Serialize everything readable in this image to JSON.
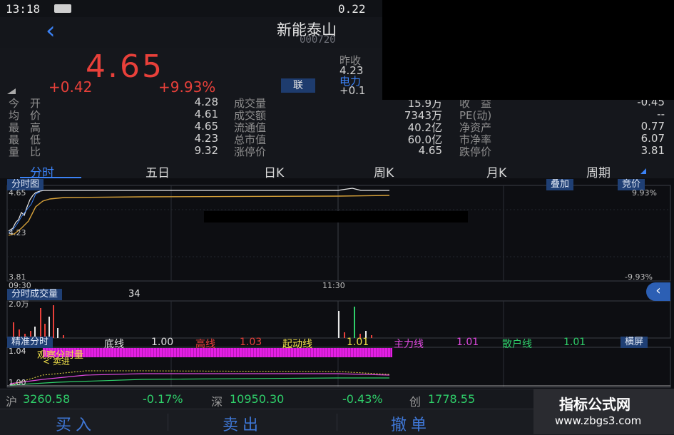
{
  "status": {
    "time": "13:18",
    "center_text": "0.22"
  },
  "header": {
    "stock_name": "新能泰山",
    "stock_code": "000720"
  },
  "quote": {
    "price": "4.65",
    "change": "+0.42",
    "change_pct": "+9.93%",
    "link_button": "联",
    "prev_close_label": "昨收",
    "prev_close_value": "4.23",
    "sector_label": "电力",
    "sector_change": "+0.1",
    "rows": [
      {
        "l1": "今　开",
        "v1": "4.28",
        "l2": "成交量",
        "v2": "15.9万",
        "l3": "收　益",
        "v3": "-0.45"
      },
      {
        "l1": "均　价",
        "v1": "4.61",
        "l2": "成交额",
        "v2": "7343万",
        "l3": "PE(动)",
        "v3": "--"
      },
      {
        "l1": "最　高",
        "v1": "4.65",
        "l2": "流通值",
        "v2": "40.2亿",
        "l3": "净资产",
        "v3": "0.77"
      },
      {
        "l1": "最　低",
        "v1": "4.23",
        "l2": "总市值",
        "v2": "60.0亿",
        "l3": "市净率",
        "v3": "6.07"
      },
      {
        "l1": "量　比",
        "v1": "9.32",
        "l2": "涨停价",
        "v2": "4.65",
        "l3": "跌停价",
        "v3": "3.81"
      }
    ]
  },
  "tabs": [
    "分时",
    "五日",
    "日K",
    "周K",
    "月K",
    "周期"
  ],
  "intraday": {
    "title": "分时图",
    "overlay_button": "叠加",
    "auction_button": "竞价",
    "high_label": "4.65",
    "mid_label": "4.23",
    "low_label": "3.81",
    "pct_high": "9.93%",
    "pct_low": "-9.93%",
    "time_start": "09:30",
    "time_mid": "11:30"
  },
  "volume": {
    "title": "分时成交量",
    "current": "34",
    "max_label": "2.0万"
  },
  "indicator": {
    "title": "精准分时",
    "items": [
      {
        "name": "底线",
        "value": "1.00",
        "color": "#e0e0e0"
      },
      {
        "name": "高线",
        "value": "1.03",
        "color": "#e8403a"
      },
      {
        "name": "起动线",
        "value": "1.01",
        "color": "#f0e04a"
      },
      {
        "name": "主力线",
        "value": "1.01",
        "color": "#e04ae0"
      },
      {
        "name": "散户线",
        "value": "1.01",
        "color": "#2fcf6a"
      }
    ],
    "fullscreen_button": "横屏",
    "top_label": "1.04",
    "bottom_label": "1.00",
    "sub_text_1": "观察分时量",
    "sub_text_2": "< 卖进"
  },
  "indices": [
    {
      "name": "沪",
      "value": "3260.58",
      "change": "-0.17%"
    },
    {
      "name": "深",
      "value": "10950.30",
      "change": "-0.43%"
    },
    {
      "name": "创",
      "value": "1778.55",
      "change": ""
    }
  ],
  "actions": {
    "buy": "买入",
    "sell": "卖出",
    "cancel": "撤单"
  },
  "watermark": {
    "line1": "指标公式网",
    "line2": "www.zbgs3.com"
  }
}
